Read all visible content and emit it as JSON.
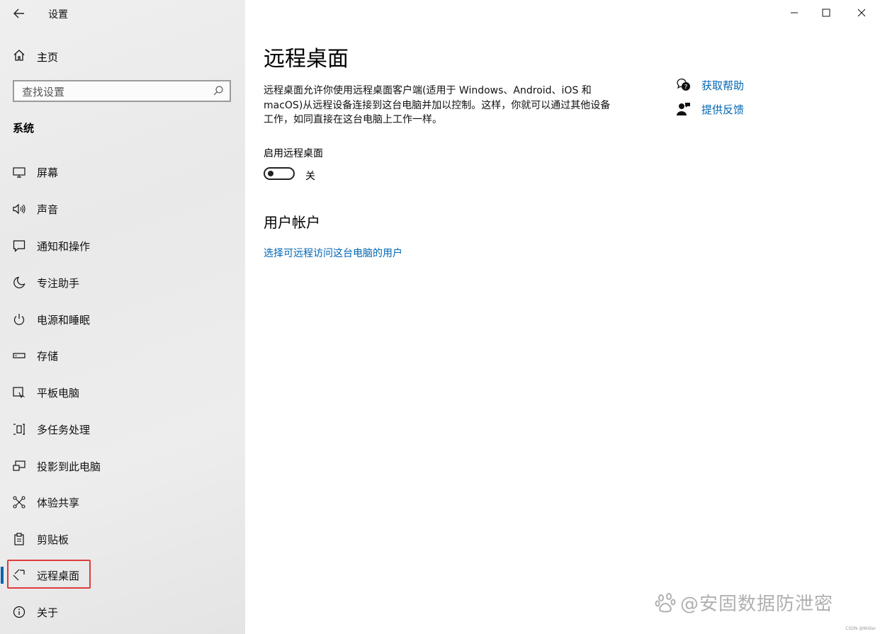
{
  "window": {
    "title": "设置",
    "controls": {
      "minimize": "minimize-icon",
      "maximize": "maximize-icon",
      "close": "close-icon"
    }
  },
  "sidebar": {
    "home_label": "主页",
    "search_placeholder": "查找设置",
    "section_title": "系统",
    "items": [
      {
        "label": "屏幕",
        "icon": "monitor-icon"
      },
      {
        "label": "声音",
        "icon": "speaker-icon"
      },
      {
        "label": "通知和操作",
        "icon": "notification-icon"
      },
      {
        "label": "专注助手",
        "icon": "moon-icon"
      },
      {
        "label": "电源和睡眠",
        "icon": "power-icon"
      },
      {
        "label": "存储",
        "icon": "storage-icon"
      },
      {
        "label": "平板电脑",
        "icon": "tablet-icon"
      },
      {
        "label": "多任务处理",
        "icon": "multitask-icon"
      },
      {
        "label": "投影到此电脑",
        "icon": "project-icon"
      },
      {
        "label": "体验共享",
        "icon": "share-icon"
      },
      {
        "label": "剪贴板",
        "icon": "clipboard-icon"
      },
      {
        "label": "远程桌面",
        "icon": "remote-desktop-icon",
        "active": true
      },
      {
        "label": "关于",
        "icon": "info-icon"
      }
    ]
  },
  "main": {
    "title": "远程桌面",
    "description": "远程桌面允许你使用远程桌面客户端(适用于 Windows、Android、iOS 和 macOS)从远程设备连接到这台电脑并加以控制。这样，你就可以通过其他设备工作，如同直接在这台电脑上工作一样。",
    "toggle_label": "启用远程桌面",
    "toggle_state": "关",
    "toggle_on": false,
    "user_section_title": "用户帐户",
    "user_link": "选择可远程访问这台电脑的用户",
    "help_link": "获取帮助",
    "feedback_link": "提供反馈"
  },
  "watermark": {
    "text": "@安固数据防泄密",
    "small": "CSDN @Nlidar"
  },
  "colors": {
    "accent": "#0063b1",
    "link": "#0066b4",
    "highlight_box": "#e03b3b"
  }
}
